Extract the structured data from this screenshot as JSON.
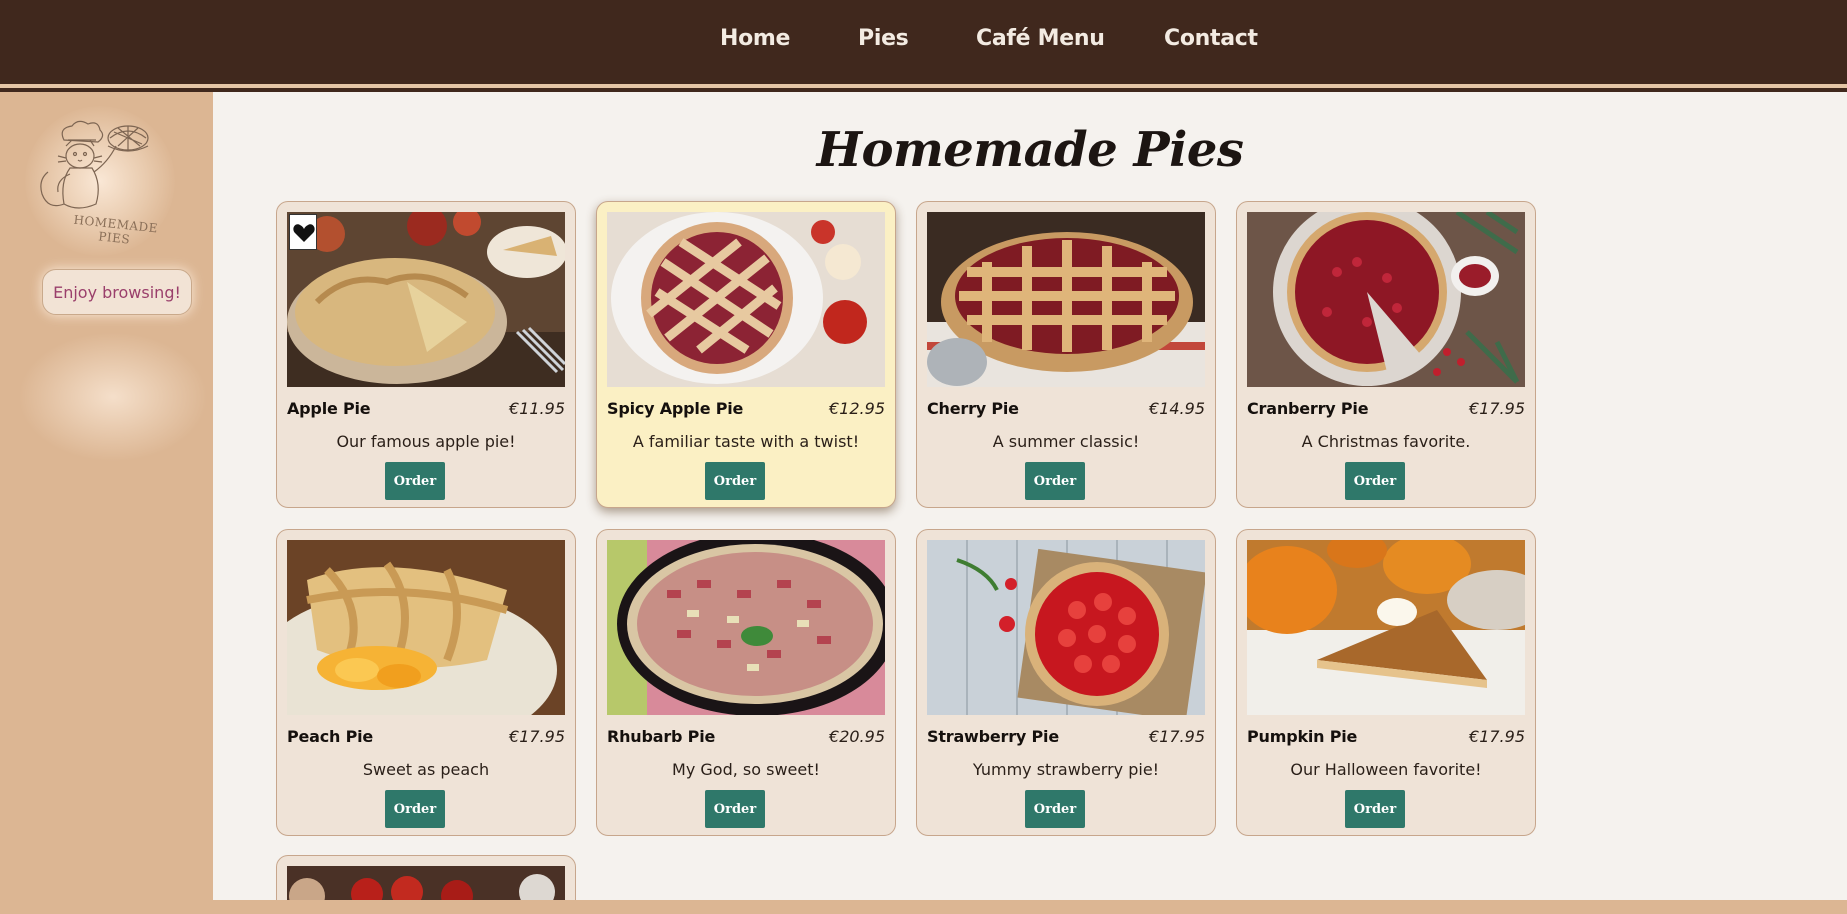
{
  "nav": {
    "items": [
      {
        "label": "Home"
      },
      {
        "label": "Pies"
      },
      {
        "label": "Café Menu"
      },
      {
        "label": "Contact"
      }
    ]
  },
  "sidebar": {
    "logo_text_line1": "HOMEMADE",
    "logo_text_line2": "PIES",
    "enjoy_label": "Enjoy browsing!"
  },
  "page": {
    "title": "Homemade Pies"
  },
  "pies": [
    {
      "name": "Apple Pie",
      "price": "€11.95",
      "desc": "Our famous apple pie!",
      "order": "Order"
    },
    {
      "name": "Spicy Apple Pie",
      "price": "€12.95",
      "desc": "A familiar taste with a twist!",
      "order": "Order"
    },
    {
      "name": "Cherry Pie",
      "price": "€14.95",
      "desc": "A summer classic!",
      "order": "Order"
    },
    {
      "name": "Cranberry Pie",
      "price": "€17.95",
      "desc": "A Christmas favorite.",
      "order": "Order"
    },
    {
      "name": "Peach Pie",
      "price": "€17.95",
      "desc": "Sweet as peach",
      "order": "Order"
    },
    {
      "name": "Rhubarb Pie",
      "price": "€20.95",
      "desc": "My God, so sweet!",
      "order": "Order"
    },
    {
      "name": "Strawberry Pie",
      "price": "€17.95",
      "desc": "Yummy strawberry pie!",
      "order": "Order"
    },
    {
      "name": "Pumpkin Pie",
      "price": "€17.95",
      "desc": "Our Halloween favorite!",
      "order": "Order"
    }
  ],
  "colors": {
    "nav_bg": "#40281d",
    "sidebar_bg": "#dcb693",
    "card_bg": "#efe3d7",
    "featured_bg": "#fbf0c4",
    "order_button": "#2f786a",
    "enjoy_text": "#9a3f6b"
  }
}
